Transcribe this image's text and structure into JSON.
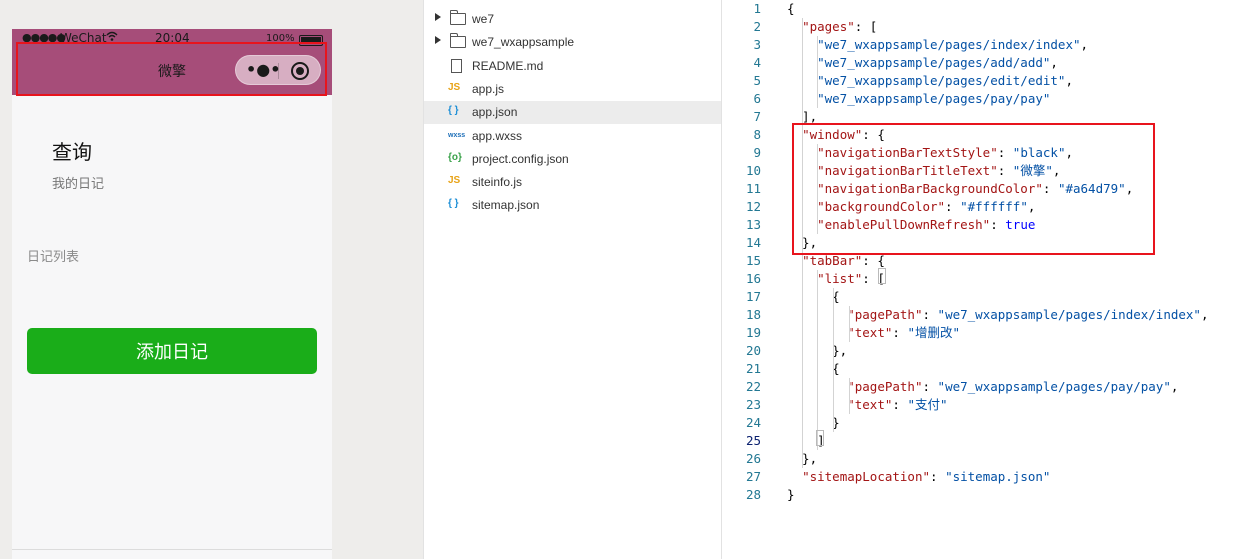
{
  "simulator": {
    "status_bar": {
      "signal": "●●●●●",
      "carrier": "WeChat",
      "wifi_icon": "wifi-icon",
      "time": "20:04",
      "battery_percent": "100%",
      "battery_level": 1.0
    },
    "nav_bar": {
      "title": "微擎",
      "more_label": "•●•",
      "background_color": "#a64d79"
    },
    "page": {
      "heading": "查询",
      "subheading": "我的日记",
      "section_label": "日记列表",
      "add_button_label": "添加日记",
      "add_button_color": "#1aad19"
    }
  },
  "file_tree": {
    "items": [
      {
        "label": "we7",
        "kind": "folder",
        "icon": "folder-icon",
        "expandable": true
      },
      {
        "label": "we7_wxappsample",
        "kind": "folder",
        "icon": "folder-icon",
        "expandable": true
      },
      {
        "label": "README.md",
        "kind": "file",
        "icon": "file-icon"
      },
      {
        "label": "app.js",
        "kind": "file",
        "icon": "js-icon",
        "badge": "JS",
        "badge_color": "#e8a317"
      },
      {
        "label": "app.json",
        "kind": "file",
        "icon": "json-icon",
        "badge": "{ }",
        "badge_color": "#1e8fd6",
        "selected": true
      },
      {
        "label": "app.wxss",
        "kind": "file",
        "icon": "wxss-icon",
        "badge": "wxss",
        "badge_color": "#1e6fb8"
      },
      {
        "label": "project.config.json",
        "kind": "file",
        "icon": "config-json-icon",
        "badge": "{o}",
        "badge_color": "#3aa24a"
      },
      {
        "label": "siteinfo.js",
        "kind": "file",
        "icon": "js-icon",
        "badge": "JS",
        "badge_color": "#e8a317"
      },
      {
        "label": "sitemap.json",
        "kind": "file",
        "icon": "json-icon",
        "badge": "{ }",
        "badge_color": "#1e8fd6"
      }
    ]
  },
  "editor": {
    "active_line": 25,
    "lines": [
      {
        "n": "1",
        "tokens": [
          [
            "p",
            "{"
          ]
        ]
      },
      {
        "n": "2",
        "tokens": [
          [
            "p",
            "  "
          ],
          [
            "k",
            "\"pages\""
          ],
          [
            "p",
            ": ["
          ]
        ]
      },
      {
        "n": "3",
        "tokens": [
          [
            "p",
            "    "
          ],
          [
            "s",
            "\"we7_wxappsample/pages/index/index\""
          ],
          [
            "p",
            ","
          ]
        ]
      },
      {
        "n": "4",
        "tokens": [
          [
            "p",
            "    "
          ],
          [
            "s",
            "\"we7_wxappsample/pages/add/add\""
          ],
          [
            "p",
            ","
          ]
        ]
      },
      {
        "n": "5",
        "tokens": [
          [
            "p",
            "    "
          ],
          [
            "s",
            "\"we7_wxappsample/pages/edit/edit\""
          ],
          [
            "p",
            ","
          ]
        ]
      },
      {
        "n": "6",
        "tokens": [
          [
            "p",
            "    "
          ],
          [
            "s",
            "\"we7_wxappsample/pages/pay/pay\""
          ]
        ]
      },
      {
        "n": "7",
        "tokens": [
          [
            "p",
            "  ],"
          ]
        ]
      },
      {
        "n": "8",
        "tokens": [
          [
            "p",
            "  "
          ],
          [
            "k",
            "\"window\""
          ],
          [
            "p",
            ": {"
          ]
        ]
      },
      {
        "n": "9",
        "tokens": [
          [
            "p",
            "    "
          ],
          [
            "k",
            "\"navigationBarTextStyle\""
          ],
          [
            "p",
            ": "
          ],
          [
            "s",
            "\"black\""
          ],
          [
            "p",
            ","
          ]
        ]
      },
      {
        "n": "10",
        "tokens": [
          [
            "p",
            "    "
          ],
          [
            "k",
            "\"navigationBarTitleText\""
          ],
          [
            "p",
            ": "
          ],
          [
            "s",
            "\"微擎\""
          ],
          [
            "p",
            ","
          ]
        ]
      },
      {
        "n": "11",
        "tokens": [
          [
            "p",
            "    "
          ],
          [
            "k",
            "\"navigationBarBackgroundColor\""
          ],
          [
            "p",
            ": "
          ],
          [
            "s",
            "\"#a64d79\""
          ],
          [
            "p",
            ","
          ]
        ]
      },
      {
        "n": "12",
        "tokens": [
          [
            "p",
            "    "
          ],
          [
            "k",
            "\"backgroundColor\""
          ],
          [
            "p",
            ": "
          ],
          [
            "s",
            "\"#ffffff\""
          ],
          [
            "p",
            ","
          ]
        ]
      },
      {
        "n": "13",
        "tokens": [
          [
            "p",
            "    "
          ],
          [
            "k",
            "\"enablePullDownRefresh\""
          ],
          [
            "p",
            ": "
          ],
          [
            "b",
            "true"
          ]
        ]
      },
      {
        "n": "14",
        "tokens": [
          [
            "p",
            "  },"
          ]
        ]
      },
      {
        "n": "15",
        "tokens": [
          [
            "p",
            "  "
          ],
          [
            "k",
            "\"tabBar\""
          ],
          [
            "p",
            ": {"
          ]
        ]
      },
      {
        "n": "16",
        "tokens": [
          [
            "p",
            "    "
          ],
          [
            "k",
            "\"list\""
          ],
          [
            "p",
            ": ["
          ]
        ]
      },
      {
        "n": "17",
        "tokens": [
          [
            "p",
            "      {"
          ]
        ]
      },
      {
        "n": "18",
        "tokens": [
          [
            "p",
            "        "
          ],
          [
            "k",
            "\"pagePath\""
          ],
          [
            "p",
            ": "
          ],
          [
            "s",
            "\"we7_wxappsample/pages/index/index\""
          ],
          [
            "p",
            ","
          ]
        ]
      },
      {
        "n": "19",
        "tokens": [
          [
            "p",
            "        "
          ],
          [
            "k",
            "\"text\""
          ],
          [
            "p",
            ": "
          ],
          [
            "s",
            "\"增删改\""
          ]
        ]
      },
      {
        "n": "20",
        "tokens": [
          [
            "p",
            "      },"
          ]
        ]
      },
      {
        "n": "21",
        "tokens": [
          [
            "p",
            "      {"
          ]
        ]
      },
      {
        "n": "22",
        "tokens": [
          [
            "p",
            "        "
          ],
          [
            "k",
            "\"pagePath\""
          ],
          [
            "p",
            ": "
          ],
          [
            "s",
            "\"we7_wxappsample/pages/pay/pay\""
          ],
          [
            "p",
            ","
          ]
        ]
      },
      {
        "n": "23",
        "tokens": [
          [
            "p",
            "        "
          ],
          [
            "k",
            "\"text\""
          ],
          [
            "p",
            ": "
          ],
          [
            "s",
            "\"支付\""
          ]
        ]
      },
      {
        "n": "24",
        "tokens": [
          [
            "p",
            "      }"
          ]
        ]
      },
      {
        "n": "25",
        "tokens": [
          [
            "p",
            "    ]"
          ]
        ]
      },
      {
        "n": "26",
        "tokens": [
          [
            "p",
            "  },"
          ]
        ]
      },
      {
        "n": "27",
        "tokens": [
          [
            "p",
            "  "
          ],
          [
            "k",
            "\"sitemapLocation\""
          ],
          [
            "p",
            ": "
          ],
          [
            "s",
            "\"sitemap.json\""
          ]
        ]
      },
      {
        "n": "28",
        "tokens": [
          [
            "p",
            "}"
          ]
        ]
      }
    ]
  }
}
